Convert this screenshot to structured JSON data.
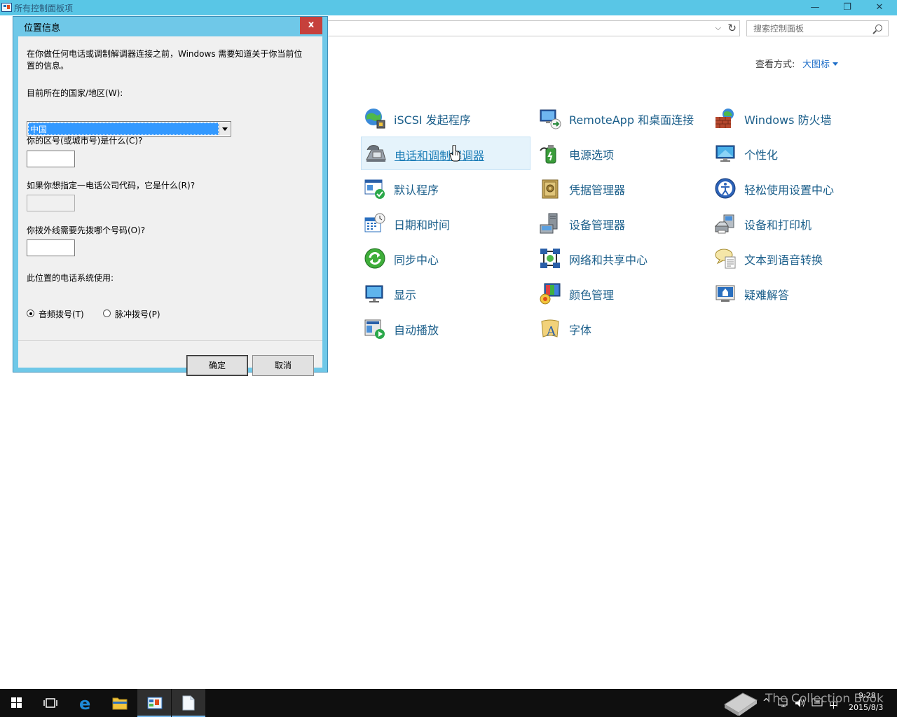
{
  "window": {
    "title": "所有控制面板项",
    "minimize": "—",
    "maximize": "❐",
    "close": "✕"
  },
  "address_bar": {
    "dropdown": "⌵",
    "refresh": "↻"
  },
  "search": {
    "placeholder": "搜索控制面板"
  },
  "view": {
    "label": "查看方式:",
    "mode": "大图标"
  },
  "control_panel_items": [
    {
      "label": "iSCSI 发起程序",
      "icon": "iscsi-globe-icon"
    },
    {
      "label": "RemoteApp 和桌面连接",
      "icon": "remoteapp-icon"
    },
    {
      "label": "Windows 防火墙",
      "icon": "firewall-icon"
    },
    {
      "label": "电话和调制解调器",
      "icon": "phone-modem-icon"
    },
    {
      "label": "电源选项",
      "icon": "power-options-icon"
    },
    {
      "label": "个性化",
      "icon": "personalization-icon"
    },
    {
      "label": "默认程序",
      "icon": "default-programs-icon"
    },
    {
      "label": "凭据管理器",
      "icon": "credential-manager-icon"
    },
    {
      "label": "轻松使用设置中心",
      "icon": "ease-of-access-icon"
    },
    {
      "label": "日期和时间",
      "icon": "date-time-icon"
    },
    {
      "label": "设备管理器",
      "icon": "device-manager-icon"
    },
    {
      "label": "设备和打印机",
      "icon": "devices-printers-icon"
    },
    {
      "label": "同步中心",
      "icon": "sync-center-icon"
    },
    {
      "label": "网络和共享中心",
      "icon": "network-sharing-icon"
    },
    {
      "label": "文本到语音转换",
      "icon": "text-to-speech-icon"
    },
    {
      "label": "显示",
      "icon": "display-icon"
    },
    {
      "label": "颜色管理",
      "icon": "color-management-icon"
    },
    {
      "label": "疑难解答",
      "icon": "troubleshooting-icon"
    },
    {
      "label": "自动播放",
      "icon": "autoplay-icon"
    },
    {
      "label": "字体",
      "icon": "fonts-icon"
    }
  ],
  "dialog": {
    "title": "位置信息",
    "close": "x",
    "intro": "在你做任何电话或调制解调器连接之前，Windows 需要知道关于你当前位置的信息。",
    "country_label": "目前所在的国家/地区(W):",
    "country_value": "中国",
    "area_code_label": "你的区号(或城市号)是什么(C)?",
    "area_code_value": "",
    "carrier_label": "如果你想指定一电话公司代码，它是什么(R)?",
    "carrier_value": "",
    "outside_line_label": "你拨外线需要先拨哪个号码(O)?",
    "outside_line_value": "",
    "dial_type_label": "此位置的电话系统使用:",
    "tone_label": "音频拨号(T)",
    "pulse_label": "脉冲拨号(P)",
    "selected_dial_type": "tone",
    "ok_label": "确定",
    "cancel_label": "取消"
  },
  "tray": {
    "watermark": "The Collection Book",
    "ime": "中",
    "time": "9:28",
    "date": "2015/8/3"
  },
  "colors": {
    "titlebar": "#59c6e6",
    "link": "#1a5e8a",
    "accent": "#1e6ec8",
    "dialog_frame": "#6fc8e8",
    "dialog_close": "#c6403c",
    "taskbar": "#0f0f0f"
  }
}
